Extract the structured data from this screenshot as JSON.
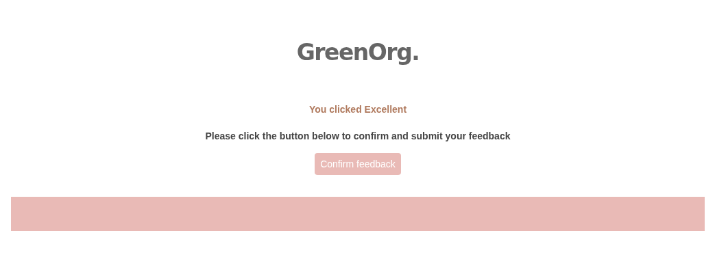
{
  "logo": {
    "text": "GreenOrg."
  },
  "message": "You clicked Excellent",
  "instruction": "Please click the button below to confirm and submit your feedback",
  "button": {
    "label": "Confirm feedback"
  },
  "footer_band": {
    "kind": "band"
  }
}
